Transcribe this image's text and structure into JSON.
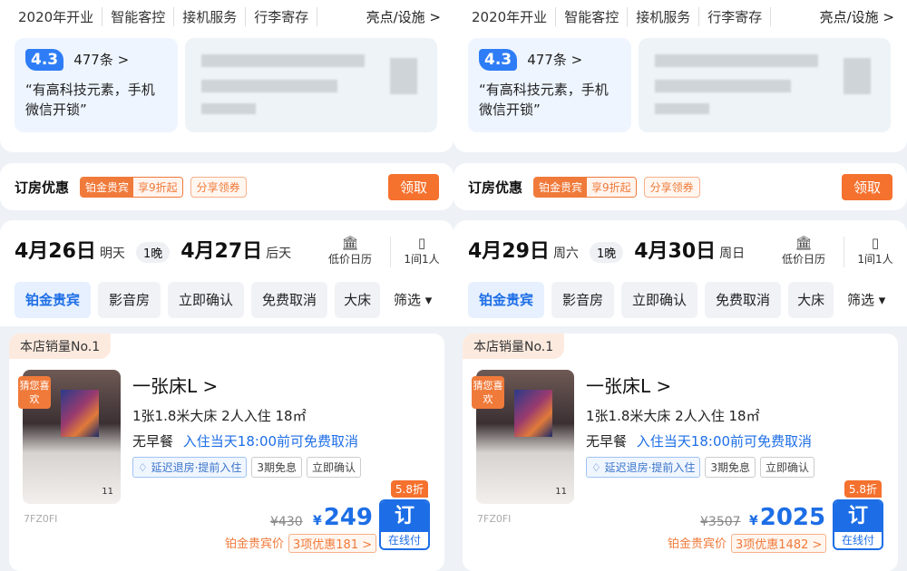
{
  "panels": [
    {
      "tags": [
        "2020年开业",
        "智能客控",
        "接机服务",
        "行李寄存"
      ],
      "tags_more": "亮点/设施 >",
      "review": {
        "score": "4.3",
        "count": "477条 >",
        "quote": "“有高科技元素，手机微信开锁”"
      },
      "offer": {
        "label": "订房优惠",
        "chip_a": "铂金贵宾",
        "chip_b": "享9折起",
        "chip2": "分享领券",
        "button": "领取"
      },
      "dates": {
        "checkin": "4月26日",
        "checkin_day": "明天",
        "nights": "1晚",
        "checkout": "4月27日",
        "checkout_day": "后天"
      },
      "calendar_label": "低价日历",
      "rooms_label": "1间1人",
      "filters": [
        "铂金贵宾",
        "影音房",
        "立即确认",
        "免费取消",
        "大床"
      ],
      "filter_button": "筛选 ▾",
      "room": {
        "sales_badge": "本店销量No.1",
        "guess": "猜您喜欢",
        "photo_count": "11",
        "code": "7FZ0FI",
        "title": "一张床L >",
        "info": "1张1.8米大床  2人入住  18㎡",
        "meal": "无早餐",
        "cancel": "入住当天18:00前可免费取消",
        "tags": [
          "延迟退房·提前入住",
          "3期免息",
          "立即确认"
        ],
        "discount": "5.8折",
        "orig_price": "¥430",
        "price_symbol": "¥",
        "price": "249",
        "price_note_a": "铂金贵宾价",
        "price_note_b": "3项优惠181 >",
        "book_big": "订",
        "book_small": "在线付"
      }
    },
    {
      "tags": [
        "2020年开业",
        "智能客控",
        "接机服务",
        "行李寄存"
      ],
      "tags_more": "亮点/设施 >",
      "review": {
        "score": "4.3",
        "count": "477条 >",
        "quote": "“有高科技元素，手机微信开锁”"
      },
      "offer": {
        "label": "订房优惠",
        "chip_a": "铂金贵宾",
        "chip_b": "享9折起",
        "chip2": "分享领券",
        "button": "领取"
      },
      "dates": {
        "checkin": "4月29日",
        "checkin_day": "周六",
        "nights": "1晚",
        "checkout": "4月30日",
        "checkout_day": "周日"
      },
      "calendar_label": "低价日历",
      "rooms_label": "1间1人",
      "filters": [
        "铂金贵宾",
        "影音房",
        "立即确认",
        "免费取消",
        "大床"
      ],
      "filter_button": "筛选 ▾",
      "room": {
        "sales_badge": "本店销量No.1",
        "guess": "猜您喜欢",
        "photo_count": "11",
        "code": "7FZ0FI",
        "title": "一张床L >",
        "info": "1张1.8米大床  2人入住  18㎡",
        "meal": "无早餐",
        "cancel": "入住当天18:00前可免费取消",
        "tags": [
          "延迟退房·提前入住",
          "3期免息",
          "立即确认"
        ],
        "discount": "5.8折",
        "orig_price": "¥3507",
        "price_symbol": "¥",
        "price": "2025",
        "price_note_a": "铂金贵宾价",
        "price_note_b": "3项优惠1482 >",
        "book_big": "订",
        "book_small": "在线付"
      }
    }
  ],
  "colors": {
    "accent_blue": "#1d6ee6",
    "accent_orange": "#f5712e"
  }
}
